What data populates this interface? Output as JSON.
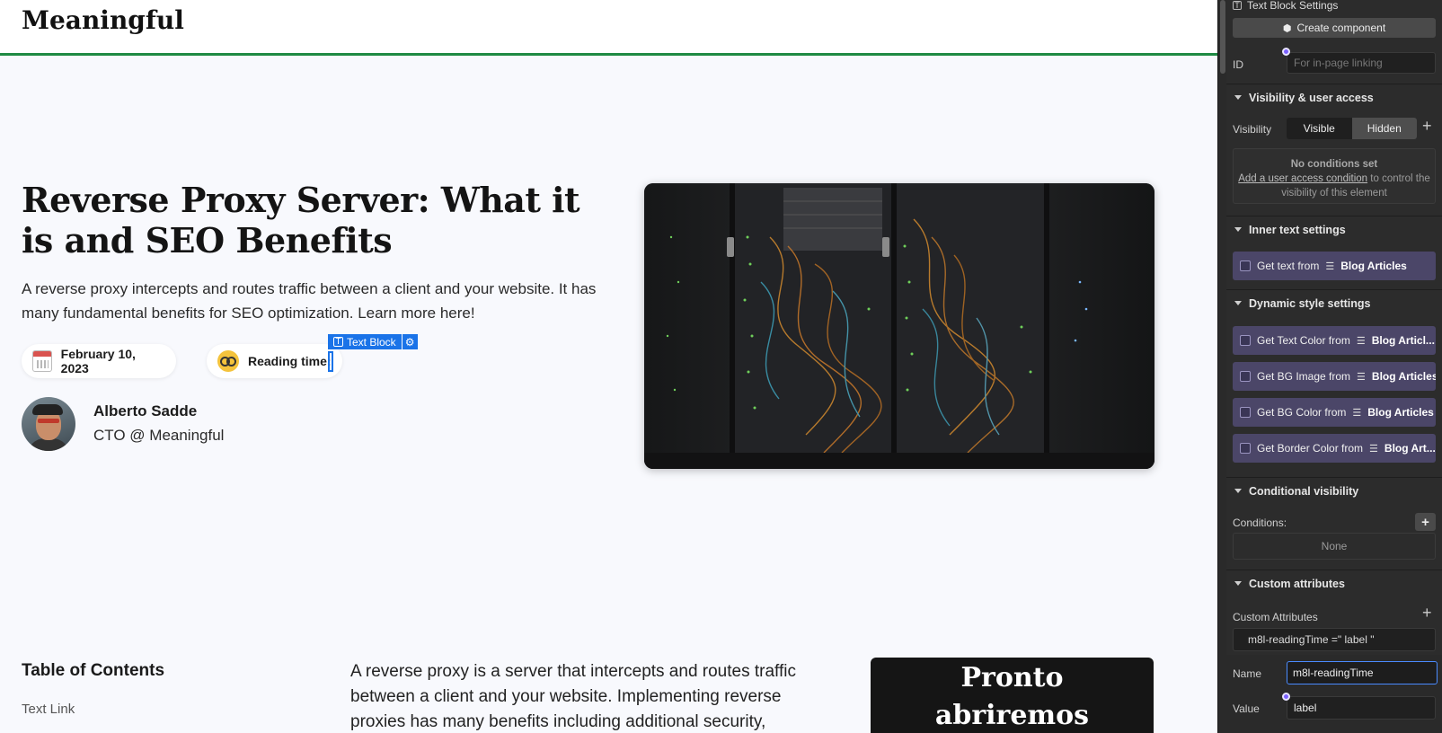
{
  "site": {
    "brand": "Meaningful",
    "hero": {
      "title": "Reverse Proxy Server: What it is and SEO Benefits",
      "description": "A reverse proxy intercepts and routes traffic between a client and your website. It has many fundamental benefits for SEO optimization. Learn more here!",
      "date": "February 10, 2023",
      "reading_label": "Reading time:"
    },
    "author": {
      "name": "Alberto Sadde",
      "role": "CTO @ Meaningful"
    },
    "selection_tag": {
      "label": "Text Block",
      "icon": "text-block-icon"
    },
    "toc": {
      "title": "Table of Contents",
      "link": "Text Link"
    },
    "article_intro": "A reverse proxy is a server that intercepts and routes traffic between a client and your website. Implementing reverse proxies has many benefits including additional security,",
    "promo": {
      "line1": "Pronto",
      "line2": "abriremos"
    }
  },
  "panel": {
    "title": "Text Block Settings",
    "create_component": "Create component",
    "id": {
      "label": "ID",
      "placeholder": "For in-page linking"
    },
    "visibility_section": {
      "heading": "Visibility & user access",
      "label": "Visibility",
      "options": [
        "Visible",
        "Hidden"
      ],
      "selected": "Hidden",
      "no_conditions": "No conditions set",
      "add_condition_link": "Add a user access condition",
      "add_condition_rest": "to control the visibility of this element"
    },
    "inner_text": {
      "heading": "Inner text settings",
      "binding_prefix": "Get text from",
      "binding_source": "Blog Articles"
    },
    "dynamic_style": {
      "heading": "Dynamic style settings",
      "bindings": [
        {
          "prefix": "Get Text Color from",
          "source": "Blog Articl..."
        },
        {
          "prefix": "Get BG Image from",
          "source": "Blog Articles"
        },
        {
          "prefix": "Get BG Color from",
          "source": "Blog Articles"
        },
        {
          "prefix": "Get Border Color from",
          "source": "Blog Art..."
        }
      ]
    },
    "conditional_visibility": {
      "heading": "Conditional visibility",
      "label": "Conditions:",
      "value": "None"
    },
    "custom_attributes": {
      "heading": "Custom attributes",
      "label": "Custom Attributes",
      "existing": "m8l-readingTime =\" label \"",
      "name_label": "Name",
      "name_value": "m8l-readingTime",
      "value_label": "Value",
      "value_value": "label"
    }
  },
  "colors": {
    "accent_green": "#1f8a43",
    "selection_blue": "#1a73e8",
    "binding_purple": "#4b4668",
    "panel_bg": "#2c2c2c"
  }
}
